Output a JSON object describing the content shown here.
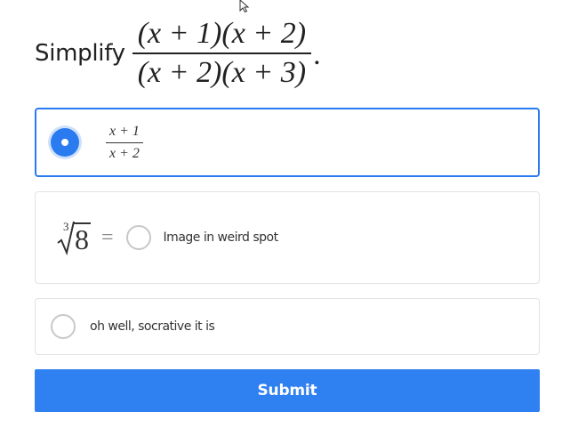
{
  "question": {
    "prefix": "Simplify",
    "numerator": "(x + 1)(x + 2)",
    "denominator": "(x + 2)(x + 3)",
    "suffix": "."
  },
  "options": [
    {
      "selected": true,
      "numerator": "x + 1",
      "denominator": "x + 2"
    },
    {
      "selected": false,
      "math_index": "3",
      "math_radicand": "8",
      "math_equals": "=",
      "label": "Image in weird spot"
    },
    {
      "selected": false,
      "label": "oh well, socrative it is"
    }
  ],
  "submit": {
    "label": "Submit"
  },
  "colors": {
    "accent": "#2f80f0",
    "selected_border": "#2b7bf0",
    "card_border": "#e2e2e2",
    "radio_border": "#c8c8c8"
  },
  "icons": {
    "cursor": "mouse-pointer-icon",
    "selected_radio": "radio-checked-icon",
    "unselected_radio": "radio-unchecked-icon",
    "root": "cube-root-icon"
  }
}
